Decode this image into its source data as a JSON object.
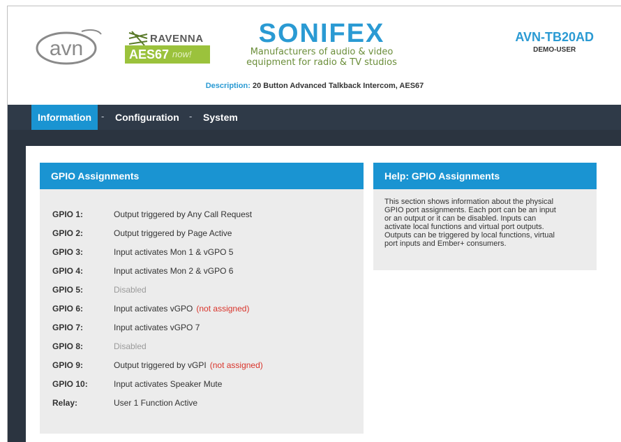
{
  "header": {
    "avn_logo": "avn",
    "ravenna_logo": "RAVENNA",
    "aes67_logo": "AES67",
    "aes67_now": "now!",
    "brand_name": "SONIFEX",
    "brand_tagline_1": "Manufacturers of audio & video",
    "brand_tagline_2": "equipment for radio & TV studios",
    "device_name": "AVN-TB20AD",
    "user": "DEMO-USER",
    "description_label": "Description:",
    "description_value": "20 Button Advanced Talkback Intercom, AES67"
  },
  "nav": {
    "items": [
      {
        "label": "Information",
        "active": true
      },
      {
        "label": "Configuration",
        "active": false
      },
      {
        "label": "System",
        "active": false
      }
    ],
    "separator": "-"
  },
  "gpio_panel": {
    "title": "GPIO Assignments",
    "rows": [
      {
        "label": "GPIO 1:",
        "value": "Output triggered by Any Call Request",
        "note": ""
      },
      {
        "label": "GPIO 2:",
        "value": "Output triggered by Page Active",
        "note": ""
      },
      {
        "label": "GPIO 3:",
        "value": "Input activates Mon 1 & vGPO 5",
        "note": ""
      },
      {
        "label": "GPIO 4:",
        "value": "Input activates Mon 2 & vGPO 6",
        "note": ""
      },
      {
        "label": "GPIO 5:",
        "value": "Disabled",
        "note": ""
      },
      {
        "label": "GPIO 6:",
        "value": "Input activates vGPO",
        "note": "(not assigned)"
      },
      {
        "label": "GPIO 7:",
        "value": "Input activates vGPO 7",
        "note": ""
      },
      {
        "label": "GPIO 8:",
        "value": "Disabled",
        "note": ""
      },
      {
        "label": "GPIO 9:",
        "value": "Output triggered by vGPI",
        "note": "(not assigned)"
      },
      {
        "label": "GPIO 10:",
        "value": "Input activates Speaker Mute",
        "note": ""
      },
      {
        "label": "Relay:",
        "value": "User 1 Function Active",
        "note": ""
      }
    ]
  },
  "help_panel": {
    "title": "Help: GPIO Assignments",
    "lines": [
      "This section shows information about the physical",
      "GPIO port assignments. Each port can be an input",
      "or an output or it can be disabled. Inputs can",
      "activate local functions and virtual port outputs.",
      "Outputs can be triggered by local functions, virtual",
      "port inputs and Ember+ consumers."
    ]
  },
  "colors": {
    "accent": "#1a94d2",
    "nav_bg": "#2f3a48",
    "brand_blue": "#2a9ad3",
    "aes_green": "#9bc23c",
    "warning_red": "#d9342b",
    "panel_bg": "#ececec"
  }
}
